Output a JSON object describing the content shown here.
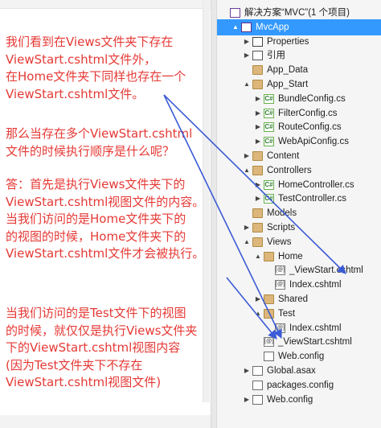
{
  "annotation": {
    "paragraphs": [
      "我们看到在Views文件夹下存在\nViewStart.cshtml文件外，\n在Home文件夹下同样也存在一个\nViewStart.cshtml文件。",
      "那么当存在多个ViewStart.cshtml\n文件的时候执行顺序是什么呢？",
      "答：首先是执行Views文件夹下的\nViewStart.cshtml视图文件的内容。\n当我们访问的是Home文件夹下的\n的视图的时候，Home文件夹下的\nViewStart.cshtml文件才会被执行。",
      "当我们访问的是Test文件下的视图\n的时候，就仅仅是执行Views文件夹\n下的ViewStart.cshtml视图内容\n(因为Test文件夹下不存在\nViewStart.cshtml视图文件)"
    ],
    "text_color": "#e53935",
    "arrow_color": "#3b5bd6"
  },
  "solution_explorer": {
    "items": [
      {
        "label": "解决方案“MVC”(1 个项目)",
        "icon": "solution-icon",
        "expander": "",
        "glyph": ""
      },
      {
        "label": "MvcApp",
        "icon": "project-icon",
        "expander": "▲",
        "glyph": "",
        "selected": true
      },
      {
        "label": "Properties",
        "icon": "properties-icon",
        "expander": "▶",
        "glyph": ""
      },
      {
        "label": "引用",
        "icon": "references-icon",
        "expander": "▶",
        "glyph": ""
      },
      {
        "label": "App_Data",
        "icon": "folder-icon",
        "expander": "",
        "glyph": ""
      },
      {
        "label": "App_Start",
        "icon": "folder-icon",
        "expander": "▲",
        "glyph": ""
      },
      {
        "label": "BundleConfig.cs",
        "icon": "csharp-file-icon",
        "expander": "▶",
        "glyph": "C#"
      },
      {
        "label": "FilterConfig.cs",
        "icon": "csharp-file-icon",
        "expander": "▶",
        "glyph": "C#"
      },
      {
        "label": "RouteConfig.cs",
        "icon": "csharp-file-icon",
        "expander": "▶",
        "glyph": "C#"
      },
      {
        "label": "WebApiConfig.cs",
        "icon": "csharp-file-icon",
        "expander": "▶",
        "glyph": "C#"
      },
      {
        "label": "Content",
        "icon": "folder-icon",
        "expander": "▶",
        "glyph": ""
      },
      {
        "label": "Controllers",
        "icon": "folder-icon",
        "expander": "▲",
        "glyph": ""
      },
      {
        "label": "HomeController.cs",
        "icon": "csharp-file-icon",
        "expander": "▶",
        "glyph": "C#"
      },
      {
        "label": "TestController.cs",
        "icon": "csharp-file-icon",
        "expander": "▶",
        "glyph": "C#"
      },
      {
        "label": "Models",
        "icon": "folder-icon",
        "expander": "",
        "glyph": ""
      },
      {
        "label": "Scripts",
        "icon": "folder-icon",
        "expander": "▶",
        "glyph": ""
      },
      {
        "label": "Views",
        "icon": "folder-icon",
        "expander": "▲",
        "glyph": ""
      },
      {
        "label": "Home",
        "icon": "folder-icon",
        "expander": "▲",
        "glyph": ""
      },
      {
        "label": "_ViewStart.cshtml",
        "icon": "razor-file-icon",
        "expander": "",
        "glyph": "[@]"
      },
      {
        "label": "Index.cshtml",
        "icon": "razor-file-icon",
        "expander": "",
        "glyph": "[@]"
      },
      {
        "label": "Shared",
        "icon": "folder-icon",
        "expander": "▶",
        "glyph": ""
      },
      {
        "label": "Test",
        "icon": "folder-icon",
        "expander": "▲",
        "glyph": ""
      },
      {
        "label": "Index.cshtml",
        "icon": "razor-file-icon",
        "expander": "",
        "glyph": "[@]"
      },
      {
        "label": "_ViewStart.cshtml",
        "icon": "razor-file-icon",
        "expander": "",
        "glyph": "[@]"
      },
      {
        "label": "Web.config",
        "icon": "config-file-icon",
        "expander": "",
        "glyph": ""
      },
      {
        "label": "Global.asax",
        "icon": "asax-file-icon",
        "expander": "▶",
        "glyph": ""
      },
      {
        "label": "packages.config",
        "icon": "config-file-icon",
        "expander": "",
        "glyph": ""
      },
      {
        "label": "Web.config",
        "icon": "config-file-icon",
        "expander": "▶",
        "glyph": ""
      }
    ]
  }
}
